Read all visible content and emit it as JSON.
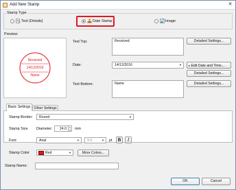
{
  "window": {
    "title": "Add New Stamp",
    "close_glyph": "✕"
  },
  "stamp_type": {
    "group_label": "Stamp Type",
    "options": [
      {
        "label": "Text (Details)",
        "icon": "text-stamp-icon",
        "checked": false
      },
      {
        "label": "Date Stamp",
        "icon": "date-stamp-icon",
        "checked": true
      },
      {
        "label": "Image",
        "icon": "image-stamp-icon",
        "checked": false
      }
    ]
  },
  "preview": {
    "label": "Preview:",
    "stamp_top": "Received",
    "stamp_date": "14/12/2016",
    "stamp_bottom": "Name",
    "stamp_color": "#e0191f"
  },
  "fields": {
    "text_top_label": "Text Top:",
    "text_top_value": "Received",
    "date_label": "Date:",
    "date_value": "14/12/2016",
    "text_bottom_label": "Text Bottom:",
    "text_bottom_value": "Name"
  },
  "buttons": {
    "detailed_settings_1": "Detailed Settings...",
    "edit_date_time": "Edit Date and Time...",
    "detailed_settings_2": "Detailed Settings...",
    "detailed_settings_3": "Detailed Settings...",
    "more_colors": "More Colors...",
    "ok": "OK",
    "cancel": "Cancel"
  },
  "tabs": [
    {
      "label": "Basic Settings",
      "active": true
    },
    {
      "label": "Other Settings",
      "active": false
    }
  ],
  "basic_settings": {
    "border_label": "Stamp Border:",
    "border_value": "Round",
    "size_label": "Stamp Size",
    "diameter_label": "Diameter:",
    "diameter_value": "24.0",
    "diameter_unit": "mm",
    "font_label": "Font",
    "font_value": "Arial",
    "font_size_value": "9.2",
    "font_size_unit": "pt",
    "bold_label": "B",
    "italic_label": "I",
    "color_label": "Stamp Color",
    "color_value": "Red"
  },
  "stamp_name": {
    "label": "Stamp Name:",
    "value": ""
  }
}
